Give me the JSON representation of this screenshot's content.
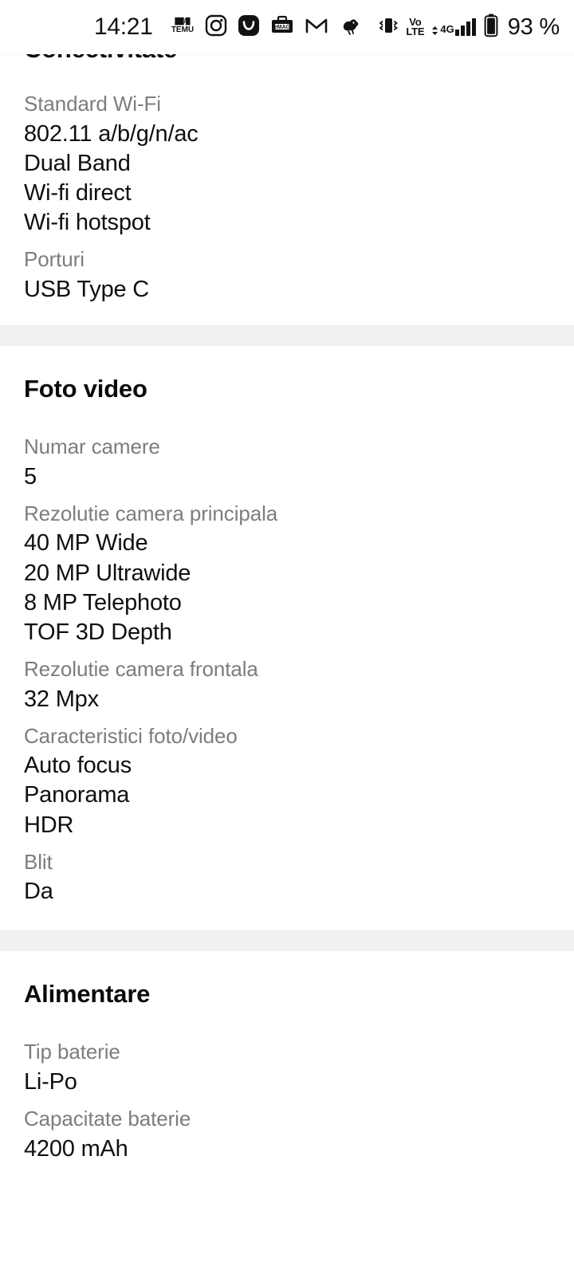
{
  "status_bar": {
    "clock": "14:21",
    "battery_percent": "93 %",
    "network_label": "4G",
    "volte_top": "Vo",
    "volte_bottom": "LTE",
    "notification_icons": [
      {
        "name": "temu-icon",
        "label": "TEMU"
      },
      {
        "name": "instagram-icon",
        "label": "Instagram"
      },
      {
        "name": "shopping-bag-icon",
        "label": "Shop"
      },
      {
        "name": "emag-icon",
        "label": "eMAG"
      },
      {
        "name": "gmail-icon",
        "label": "Gmail"
      },
      {
        "name": "bird-icon",
        "label": "Bird"
      }
    ],
    "right_icons": [
      {
        "name": "vibrate-icon"
      },
      {
        "name": "volte-icon"
      },
      {
        "name": "signal-bars-icon"
      },
      {
        "name": "battery-icon"
      }
    ]
  },
  "scrolled_section_heading": "Conectivitate",
  "sections": [
    {
      "title": "Conectivitate",
      "title_visible": false,
      "specs": [
        {
          "label": "Standard Wi-Fi",
          "value": "802.11 a/b/g/n/ac\nDual Band\nWi-fi direct\nWi-fi hotspot"
        },
        {
          "label": "Porturi",
          "value": "USB Type C"
        }
      ]
    },
    {
      "title": "Foto video",
      "title_visible": true,
      "specs": [
        {
          "label": "Numar camere",
          "value": "5"
        },
        {
          "label": "Rezolutie camera principala",
          "value": "40 MP Wide\n20 MP Ultrawide\n8 MP Telephoto\nTOF 3D Depth"
        },
        {
          "label": "Rezolutie camera frontala",
          "value": "32 Mpx"
        },
        {
          "label": "Caracteristici foto/video",
          "value": "Auto focus\nPanorama\nHDR"
        },
        {
          "label": "Blit",
          "value": "Da"
        }
      ]
    },
    {
      "title": "Alimentare",
      "title_visible": true,
      "specs": [
        {
          "label": "Tip baterie",
          "value": "Li-Po"
        },
        {
          "label": "Capacitate baterie",
          "value": "4200 mAh"
        }
      ]
    }
  ],
  "colors": {
    "page_background": "#ffffff",
    "label_text": "#7d7d7d",
    "value_text": "#101010",
    "heading_text": "#0b0b0b",
    "separator_band": "#f1f1f1"
  }
}
